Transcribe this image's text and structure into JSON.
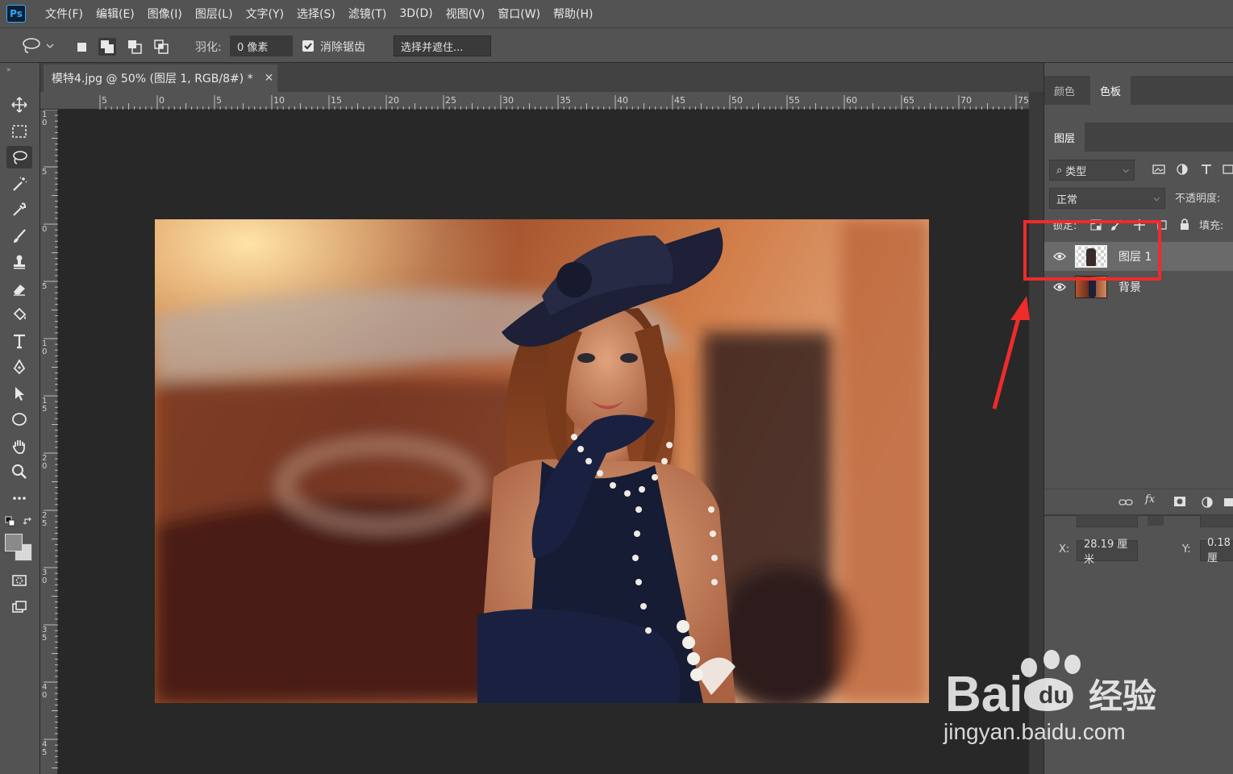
{
  "app": {
    "logo": "Ps",
    "menu": [
      "文件(F)",
      "编辑(E)",
      "图像(I)",
      "图层(L)",
      "文字(Y)",
      "选择(S)",
      "滤镜(T)",
      "3D(D)",
      "视图(V)",
      "窗口(W)",
      "帮助(H)"
    ]
  },
  "options": {
    "feather_label": "羽化:",
    "feather_value": "0 像素",
    "antialias_label": "消除锯齿",
    "antialias_checked": true,
    "select_mask_button": "选择并遮住..."
  },
  "document": {
    "tab_title": "模特4.jpg @ 50% (图层 1, RGB/8#) *",
    "ruler_top": [
      "5",
      "0",
      "5",
      "10",
      "15",
      "20",
      "25",
      "30",
      "35",
      "40",
      "45",
      "50",
      "55",
      "60",
      "65",
      "70",
      "75"
    ],
    "ruler_left": [
      "1\n0",
      "5",
      "0",
      "5",
      "1\n0",
      "1\n5",
      "2\n0",
      "2\n5",
      "3\n0",
      "3\n5",
      "4\n0",
      "4\n5"
    ]
  },
  "panels": {
    "top_tabs": [
      "颜色",
      "色板"
    ],
    "layers_tab": "图层",
    "filter_kind": "类型",
    "blend_mode": "正常",
    "opacity_label": "不透明度:",
    "lock_label": "锁定:",
    "fill_label": "填充:",
    "layers": [
      {
        "name": "图层 1",
        "selected": true
      },
      {
        "name": "背景",
        "selected": false
      }
    ],
    "footer_fx": "fx",
    "x_label": "X:",
    "x_value": "28.19 厘米",
    "y_label": "Y:",
    "y_value": "0.18 厘"
  },
  "watermark": {
    "brand": "Bai",
    "brand_cn": "经验",
    "url": "jingyan.baidu.com"
  },
  "colors": {
    "highlight": "#ef2b2b",
    "accent": "#31a8ff"
  }
}
